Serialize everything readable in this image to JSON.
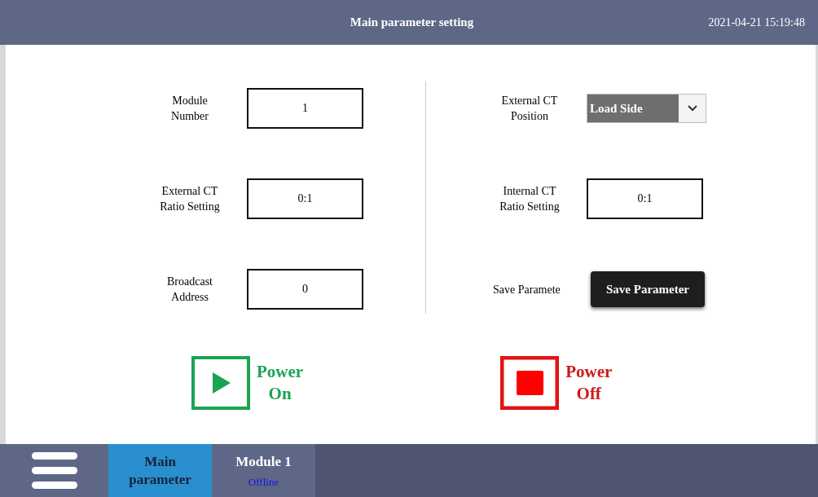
{
  "header": {
    "title": "Main parameter setting",
    "datetime": "2021-04-21 15:19:48"
  },
  "left_fields": [
    {
      "kind": "input",
      "label": "Module\nNumber",
      "value": "1"
    },
    {
      "kind": "input",
      "label": "External CT\nRatio Setting",
      "value": "0:1"
    },
    {
      "kind": "input",
      "label": "Broadcast\nAddress",
      "value": "0"
    }
  ],
  "right_fields": [
    {
      "kind": "dropdown",
      "label": "External CT\nPosition",
      "value": "Load Side"
    },
    {
      "kind": "input",
      "label": "Internal CT\nRatio Setting",
      "value": "0:1"
    },
    {
      "kind": "button",
      "label": "Save Paramete",
      "value": "Save Parameter"
    }
  ],
  "power_buttons": [
    {
      "kind": "on",
      "label": "Power\nOn"
    },
    {
      "kind": "off",
      "label": "Power\nOff"
    }
  ],
  "nav_tabs": [
    {
      "label": "Main\nparameter",
      "selected": true
    },
    {
      "label": "Module 1",
      "selected": false,
      "status": "Offline"
    }
  ]
}
